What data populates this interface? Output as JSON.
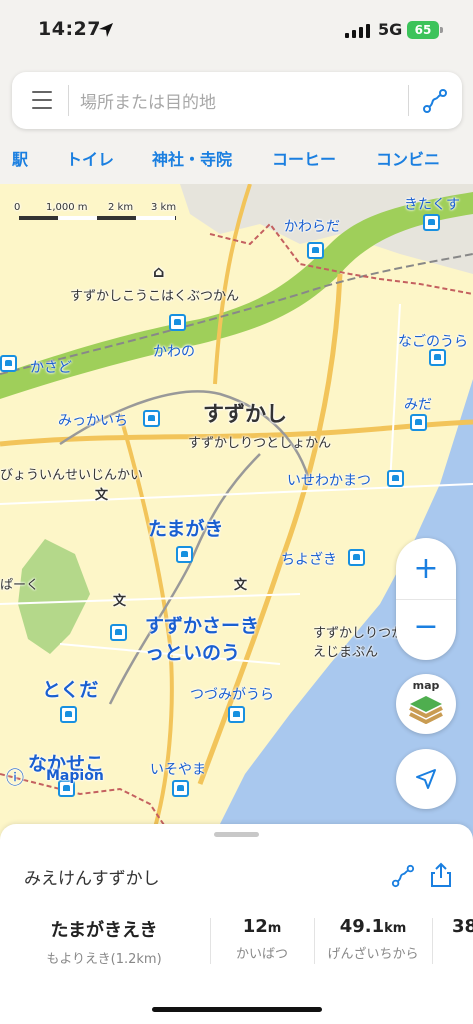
{
  "status": {
    "time": "14:27",
    "network": "5G",
    "battery": "65"
  },
  "search": {
    "placeholder": "場所または目的地"
  },
  "categories": [
    "駅",
    "トイレ",
    "神社・寺院",
    "コーヒー",
    "コンビニ"
  ],
  "map": {
    "scale": {
      "labels": [
        "0",
        "1,000 m",
        "2 km",
        "3 km"
      ]
    },
    "city": "すずかし",
    "stations": [
      "かわらだ",
      "きたくす",
      "かわの",
      "かさど",
      "なごのうら",
      "みだ",
      "みっかいち",
      "いせわかまつ",
      "たまがき",
      "ちよざき",
      "すずかさーきっといのう",
      "とくだ",
      "つづみがうら",
      "なかせこ",
      "いそやま"
    ],
    "places": [
      "すずかしこうこはくぶつかん",
      "すずかしりつとしょかん",
      "びょういんせいじんかい",
      "ぱーく",
      "すずかしりつかんえじまぷん"
    ],
    "logo": "Mapion",
    "zoom_in": "+",
    "zoom_out": "−",
    "layer_label": "map",
    "label_station_suffix": "▣"
  },
  "sheet": {
    "place": "みえけんすずかし",
    "stats": [
      {
        "value": "たまがきえき",
        "unit": "",
        "label": "もよりえき(1.2km)"
      },
      {
        "value": "12",
        "unit": "m",
        "label": "かいばつ"
      },
      {
        "value": "49.1",
        "unit": "km",
        "label": "げんざいちから"
      },
      {
        "value": "38",
        "unit": "",
        "label": ""
      }
    ]
  },
  "colors": {
    "accent": "#1a7fe0",
    "map_bg": "#fdf6c8",
    "sea": "#a9c8ee",
    "river": "#9fcf5a",
    "station": "#1890e0"
  }
}
